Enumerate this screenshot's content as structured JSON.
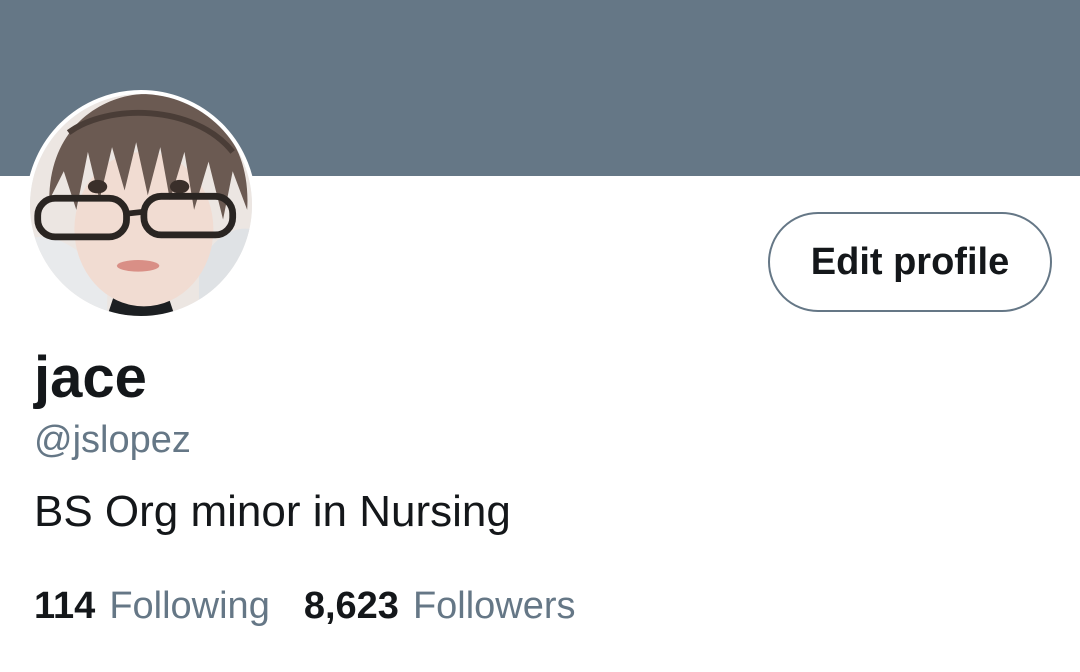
{
  "colors": {
    "banner": "#657786",
    "text_primary": "#14171a",
    "text_secondary": "#657786",
    "button_border": "#657786"
  },
  "profile": {
    "display_name": "jace",
    "handle": "@jslopez",
    "bio": "BS Org minor in Nursing",
    "avatar_icon": "avatar-photo",
    "edit_button_label": "Edit profile"
  },
  "stats": {
    "following_count": "114",
    "following_label": "Following",
    "followers_count": "8,623",
    "followers_label": "Followers"
  }
}
